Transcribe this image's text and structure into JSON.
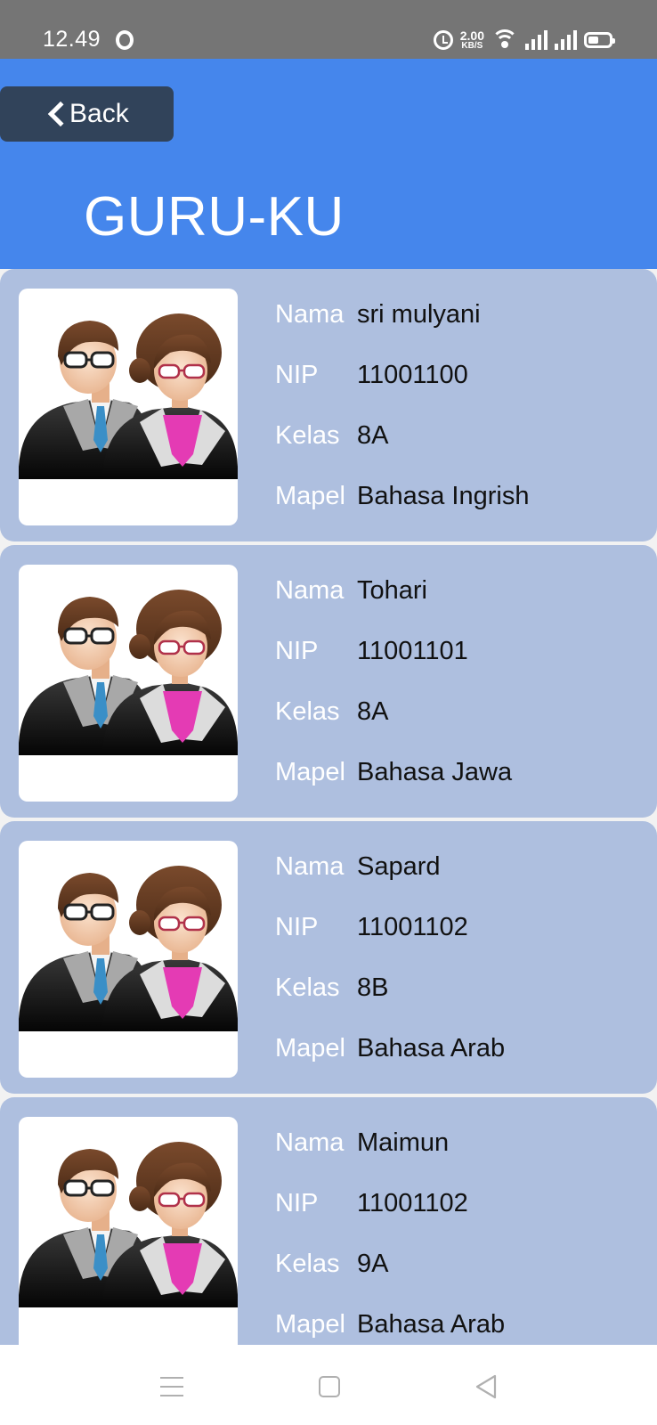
{
  "status_bar": {
    "time": "12.49",
    "speed_value": "2.00",
    "speed_unit": "KB/S"
  },
  "header": {
    "back_label": "Back",
    "title": "GURU-KU",
    "color": "#4586ec"
  },
  "labels": {
    "nama": "Nama",
    "nip": "NIP",
    "kelas": "Kelas",
    "mapel": "Mapel"
  },
  "teachers": [
    {
      "nama": "sri mulyani",
      "nip": "11001100",
      "kelas": "8A",
      "mapel": "Bahasa Ingrish"
    },
    {
      "nama": "Tohari",
      "nip": "11001101",
      "kelas": "8A",
      "mapel": "Bahasa Jawa"
    },
    {
      "nama": "Sapard",
      "nip": "11001102",
      "kelas": "8B",
      "mapel": "Bahasa Arab"
    },
    {
      "nama": "Maimun",
      "nip": "11001102",
      "kelas": "9A",
      "mapel": "Bahasa Arab"
    }
  ],
  "icons": {
    "avatar": "teachers-avatar-icon",
    "back": "chevron-left-icon",
    "nav": [
      "menu-icon",
      "home-icon",
      "back-triangle-icon"
    ]
  }
}
